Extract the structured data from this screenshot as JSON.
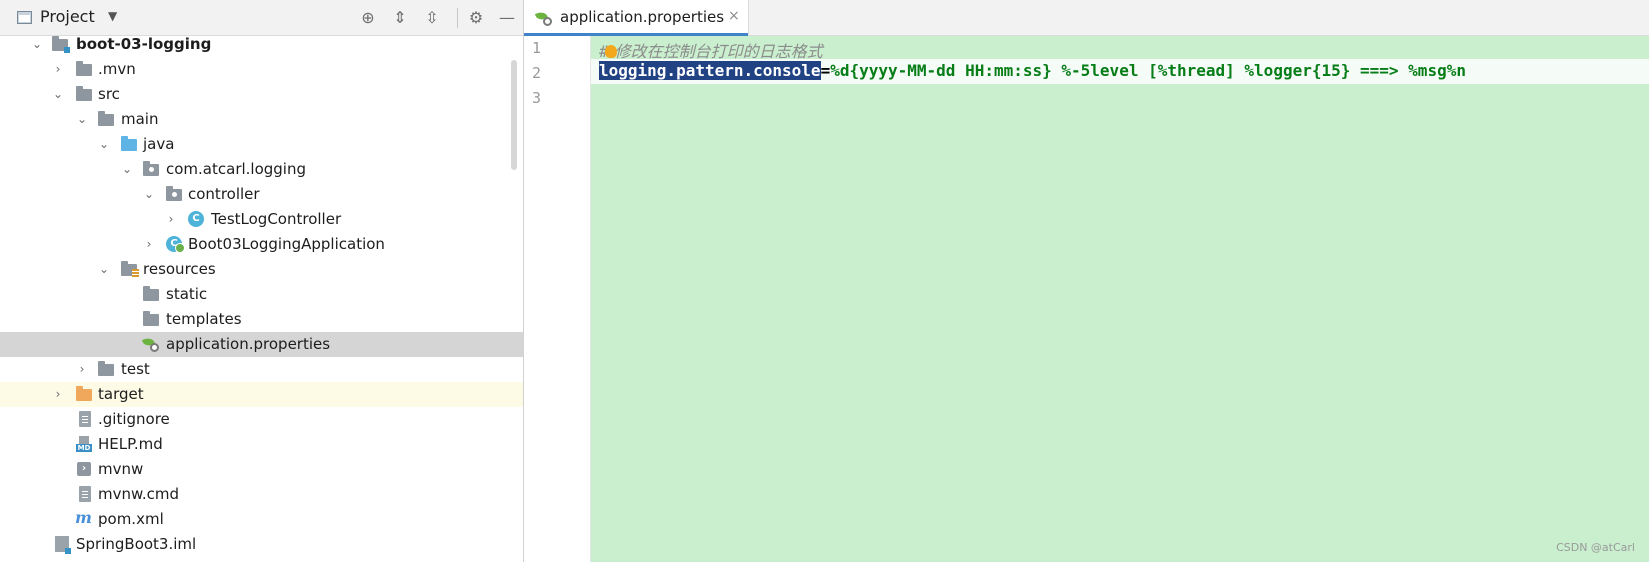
{
  "project_panel": {
    "title": "Project",
    "toolbar": {
      "locate_icon": "crosshair-icon",
      "expand_icon": "expand-all-icon",
      "collapse_icon": "collapse-all-icon",
      "settings_icon": "gear-icon",
      "hide_icon": "minus-icon"
    },
    "tree": [
      {
        "label": "boot-03-logging",
        "icon": "module-folder-icon",
        "expanded": true
      },
      {
        "label": ".mvn",
        "icon": "folder-icon",
        "expanded": false
      },
      {
        "label": "src",
        "icon": "folder-icon",
        "expanded": true
      },
      {
        "label": "main",
        "icon": "folder-icon",
        "expanded": true
      },
      {
        "label": "java",
        "icon": "source-folder-icon",
        "expanded": true
      },
      {
        "label": "com.atcarl.logging",
        "icon": "package-icon",
        "expanded": true
      },
      {
        "label": "controller",
        "icon": "package-icon",
        "expanded": true
      },
      {
        "label": "TestLogController",
        "icon": "class-icon",
        "expanded": false
      },
      {
        "label": "Boot03LoggingApplication",
        "icon": "spring-boot-class-icon",
        "expanded": false
      },
      {
        "label": "resources",
        "icon": "resources-folder-icon",
        "expanded": true
      },
      {
        "label": "static",
        "icon": "folder-icon"
      },
      {
        "label": "templates",
        "icon": "folder-icon"
      },
      {
        "label": "application.properties",
        "icon": "spring-properties-icon",
        "selected": true
      },
      {
        "label": "test",
        "icon": "folder-icon",
        "expanded": false
      },
      {
        "label": "target",
        "icon": "excluded-folder-icon",
        "expanded": false
      },
      {
        "label": ".gitignore",
        "icon": "text-file-icon"
      },
      {
        "label": "HELP.md",
        "icon": "markdown-file-icon"
      },
      {
        "label": "mvnw",
        "icon": "shell-script-icon"
      },
      {
        "label": "mvnw.cmd",
        "icon": "text-file-icon"
      },
      {
        "label": "pom.xml",
        "icon": "maven-icon"
      },
      {
        "label": "SpringBoot3.iml",
        "icon": "iml-file-icon"
      }
    ]
  },
  "editor": {
    "tab": {
      "label": "application.properties",
      "close": "×"
    },
    "lines": [
      {
        "number": "1",
        "hash": "#",
        "comment": "修改在控制台打印的日志格式"
      },
      {
        "number": "2",
        "key": "logging.pattern.console",
        "eq": "=",
        "value": "%d{yyyy-MM-dd HH:mm:ss} %-5level [%thread] %logger{15} ===> %msg%n"
      },
      {
        "number": "3"
      }
    ]
  },
  "watermark": "CSDN @atCarl",
  "colors": {
    "editor_background": "#c9efce",
    "selection": "#214283",
    "property_value": "#067d17",
    "selected_row": "#d5d5d5"
  }
}
